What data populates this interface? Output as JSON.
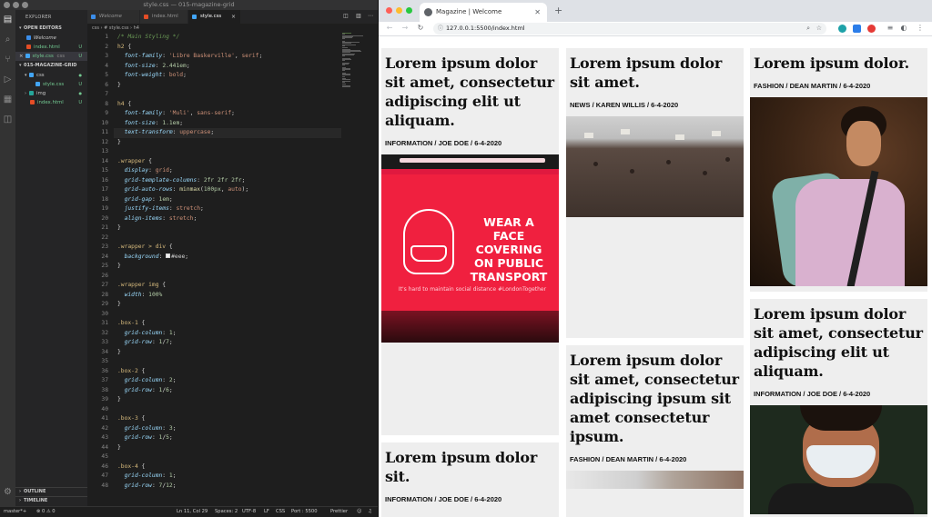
{
  "vscode": {
    "window_title": "style.css — 015-magazine-grid",
    "sidebar": {
      "title": "EXPLORER",
      "open_editors_label": "OPEN EDITORS",
      "open_editors": [
        {
          "name": "Welcome",
          "badge": ""
        },
        {
          "name": "index.html",
          "badge": "U"
        },
        {
          "name": "style.css",
          "path": "css",
          "badge": "U"
        }
      ],
      "folder_label": "015-MAGAZINE-GRID",
      "tree": [
        {
          "name": "css",
          "badge": "●"
        },
        {
          "name": "style.css",
          "badge": "U"
        },
        {
          "name": "img",
          "badge": "●"
        },
        {
          "name": "index.html",
          "badge": "U"
        }
      ],
      "outline_label": "OUTLINE",
      "timeline_label": "TIMELINE"
    },
    "tabs": [
      {
        "label": "Welcome",
        "active": false
      },
      {
        "label": "index.html",
        "active": false
      },
      {
        "label": "style.css",
        "active": true
      }
    ],
    "breadcrumb": "css  ›  # style.css  ›  h4",
    "code_lines": [
      "/* Main Styling */",
      "h2 {",
      "  font-family: 'Libre Baskerville', serif;",
      "  font-size: 2.441em;",
      "  font-weight: bold;",
      "}",
      "",
      "h4 {",
      "  font-family: 'Muli', sans-serif;",
      "  font-size: 1.1em;",
      "  text-transform: uppercase;",
      "}",
      "",
      ".wrapper {",
      "  display: grid;",
      "  grid-template-columns: 2fr 2fr 2fr;",
      "  grid-auto-rows: minmax(100px, auto);",
      "  grid-gap: 1em;",
      "  justify-items: stretch;",
      "  align-items: stretch;",
      "}",
      "",
      ".wrapper > div {",
      "  background: #eee;",
      "}",
      "",
      ".wrapper img {",
      "  width: 100%",
      "}",
      "",
      ".box-1 {",
      "  grid-column: 1;",
      "  grid-row: 1/7;",
      "}",
      "",
      ".box-2 {",
      "  grid-column: 2;",
      "  grid-row: 1/6;",
      "}",
      "",
      ".box-3 {",
      "  grid-column: 3;",
      "  grid-row: 1/5;",
      "}",
      "",
      ".box-4 {",
      "  grid-column: 1;",
      "  grid-row: 7/12;"
    ],
    "status": {
      "branch": "master*+",
      "problems": "⊗ 0  ⚠ 0",
      "position": "Ln 11, Col 29",
      "spaces": "Spaces: 2",
      "encoding": "UTF-8",
      "eol": "LF",
      "language": "CSS",
      "port": "Port : 5500",
      "formatter": "Prettier"
    }
  },
  "browser": {
    "tab_title": "Magazine | Welcome",
    "url": "127.0.0.1:5500/index.html",
    "articles": [
      {
        "title": "Lorem ipsum dolor sit amet, consectetur adipiscing elit ut aliquam.",
        "meta": "INFORMATION / JOE DOE / 6-4-2020"
      },
      {
        "title": "Lorem ipsum dolor sit amet.",
        "meta": "NEWS / KAREN WILLIS / 6-4-2020"
      },
      {
        "title": "Lorem ipsum dolor.",
        "meta": "FASHION / DEAN MARTIN / 6-4-2020"
      },
      {
        "title": "Lorem ipsum dolor sit.",
        "meta": "INFORMATION / JOE DOE / 6-4-2020"
      },
      {
        "title": "Lorem ipsum dolor sit amet, consectetur adipiscing ipsum sit amet consectetur ipsum.",
        "meta": "FASHION / DEAN MARTIN / 6-4-2020"
      },
      {
        "title": "Lorem ipsum dolor sit amet, consectetur adipiscing elit ut aliquam.",
        "meta": "INFORMATION / JOE DOE / 6-4-2020"
      }
    ],
    "image_text": {
      "headline": "WEAR A FACE COVERING ON PUBLIC TRANSPORT",
      "subline": "It's hard to maintain social distance #LondonTogether"
    }
  }
}
